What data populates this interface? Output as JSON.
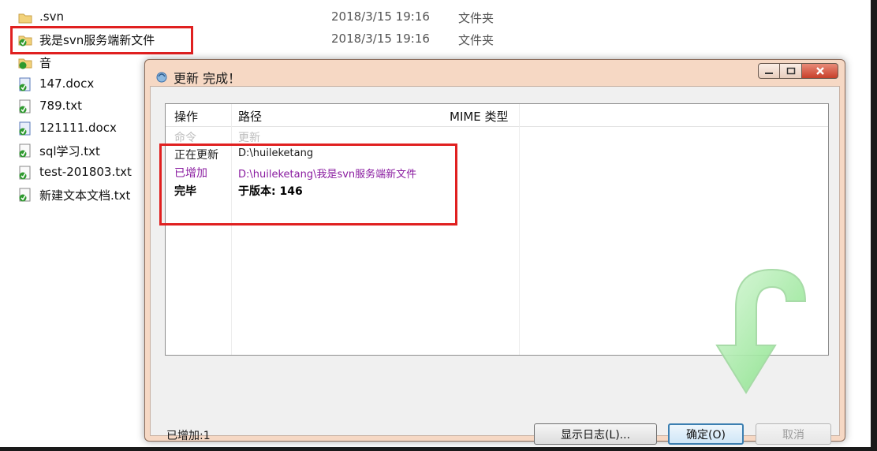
{
  "explorer": {
    "files": [
      {
        "name": ".svn",
        "date": "2018/3/15 19:16",
        "type": "文件夹",
        "icon": "folder-icon"
      },
      {
        "name": "我是svn服务端新文件",
        "date": "2018/3/15 19:16",
        "type": "文件夹",
        "icon": "svn-folder-icon"
      },
      {
        "name": "",
        "date": "",
        "type": "",
        "icon": "svn-folder-icon"
      },
      {
        "name": "147.docx",
        "date": "",
        "type": "",
        "icon": "svn-docx-icon"
      },
      {
        "name": "789.txt",
        "date": "",
        "type": "",
        "icon": "svn-file-icon"
      },
      {
        "name": "121111.docx",
        "date": "",
        "type": "",
        "icon": "svn-docx-icon"
      },
      {
        "name": "sql学习.txt",
        "date": "",
        "type": "",
        "icon": "svn-file-icon"
      },
      {
        "name": "test-201803.txt",
        "date": "",
        "type": "",
        "icon": "svn-file-icon"
      },
      {
        "name": "新建文本文档.txt",
        "date": "",
        "type": "",
        "icon": "svn-file-icon"
      }
    ],
    "partial_row_name": "音"
  },
  "dialog": {
    "title": "更新 完成！",
    "columns": {
      "action": "操作",
      "path": "路径",
      "mime": "MIME 类型"
    },
    "rows": [
      {
        "action": "命令",
        "path": "更新",
        "style": "faded"
      },
      {
        "action": "正在更新",
        "path": "D:\\huileketang",
        "style": "update"
      },
      {
        "action": "已增加",
        "path": "D:\\huileketang\\我是svn服务端新文件",
        "style": "added"
      },
      {
        "action": "完毕",
        "path": "于版本: 146",
        "style": "done"
      }
    ],
    "status": "已增加:1",
    "buttons": {
      "show_log": "显示日志(L)...",
      "ok": "确定(O)",
      "cancel": "取消"
    }
  },
  "colors": {
    "highlight": "#e02020",
    "added": "#8a1ca0",
    "dialog_bg": "#f6d8c4",
    "arrow": "#7ee07e"
  }
}
